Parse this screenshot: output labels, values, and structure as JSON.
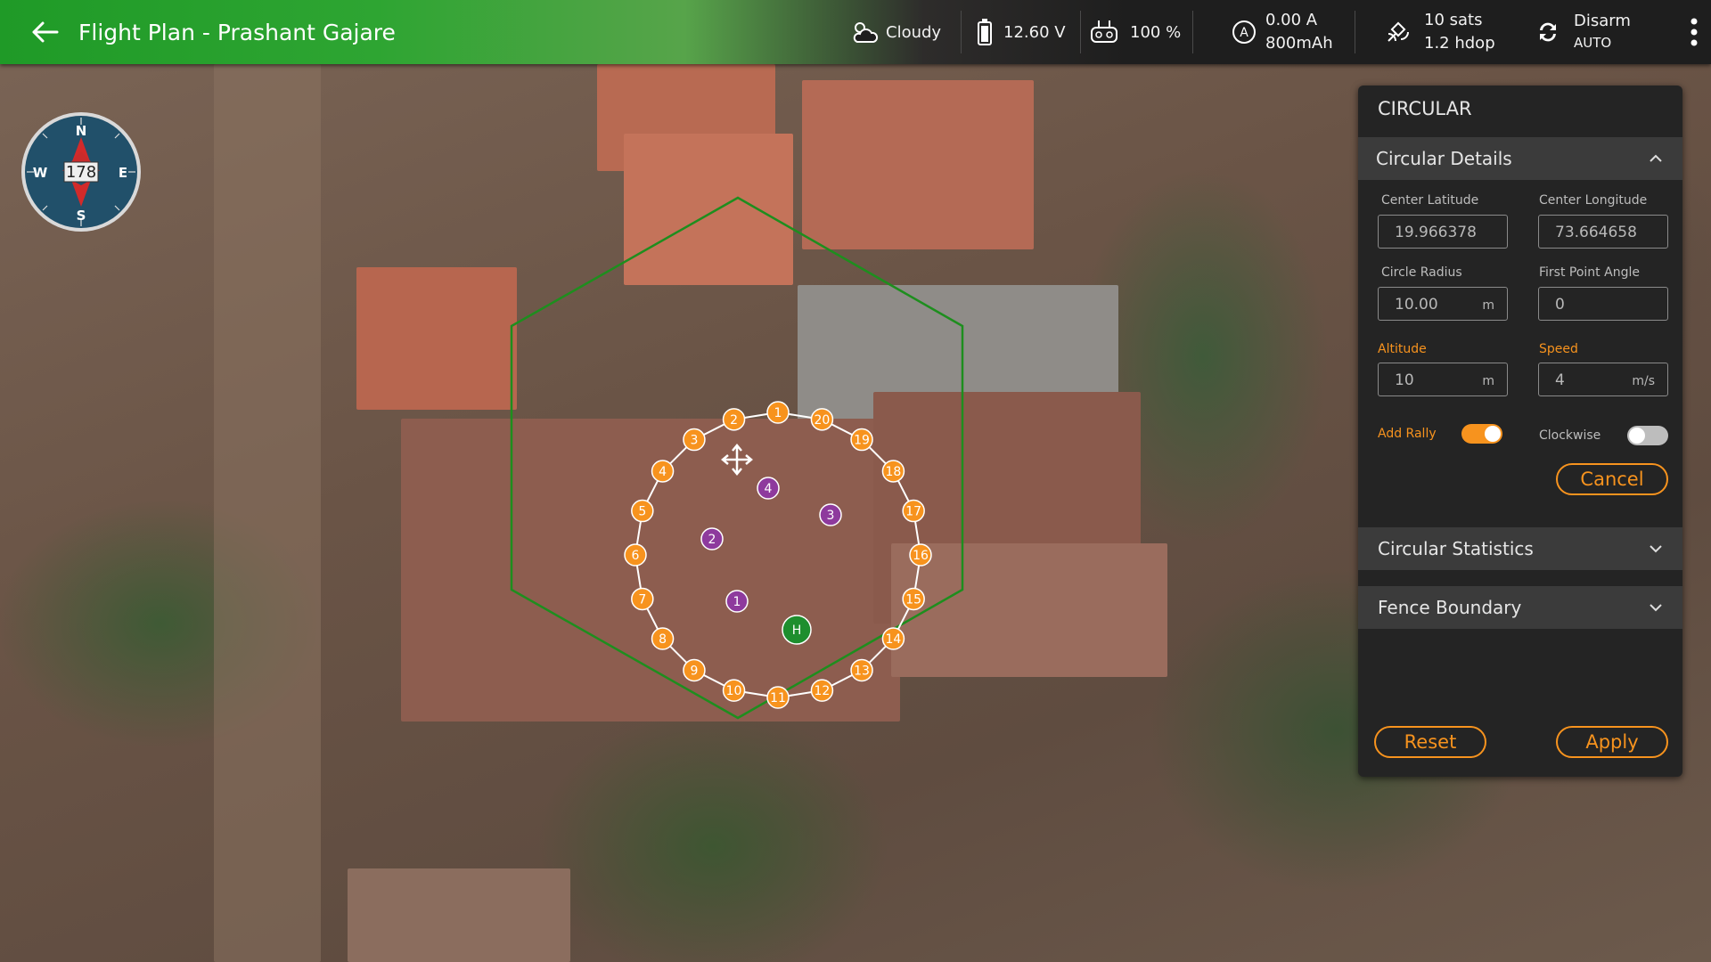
{
  "header": {
    "title": "Flight Plan - Prashant Gajare",
    "weather": "Cloudy",
    "voltage": "12.60 V",
    "rc_signal": "100 %",
    "current": "0.00 A",
    "capacity": "800mAh",
    "gps_sats": "10 sats",
    "gps_hdop": "1.2 hdop",
    "arm_state": "Disarm",
    "flight_mode": "AUTO"
  },
  "compass": {
    "heading": "178",
    "north": "N",
    "south": "S",
    "east": "E",
    "west": "W"
  },
  "map": {
    "waypoints": [
      "1",
      "2",
      "3",
      "4",
      "5",
      "6",
      "7",
      "8",
      "9",
      "10",
      "11",
      "12",
      "13",
      "14",
      "15",
      "16",
      "17",
      "18",
      "19",
      "20"
    ],
    "rally_points": [
      "1",
      "2",
      "3",
      "4"
    ],
    "home_label": "H",
    "colors": {
      "waypoint": "#f7931e",
      "rally": "#8e3a9d",
      "home": "#1e8e2e",
      "fence": "#1e8e1e"
    }
  },
  "panel": {
    "title": "CIRCULAR",
    "details_title": "Circular Details",
    "center_lat_label": "Center Latitude",
    "center_lat": "19.966378",
    "center_lon_label": "Center Longitude",
    "center_lon": "73.664658",
    "radius_label": "Circle Radius",
    "radius": "10.00",
    "radius_unit": "m",
    "first_angle_label": "First Point Angle",
    "first_angle": "0",
    "altitude_label": "Altitude",
    "altitude": "10",
    "altitude_unit": "m",
    "speed_label": "Speed",
    "speed": "4",
    "speed_unit": "m/s",
    "add_rally_label": "Add Rally",
    "add_rally_on": true,
    "clockwise_label": "Clockwise",
    "clockwise_on": false,
    "cancel_label": "Cancel",
    "statistics_title": "Circular Statistics",
    "fence_title": "Fence Boundary",
    "reset_label": "Reset",
    "apply_label": "Apply",
    "accent_color": "#f7931e"
  }
}
